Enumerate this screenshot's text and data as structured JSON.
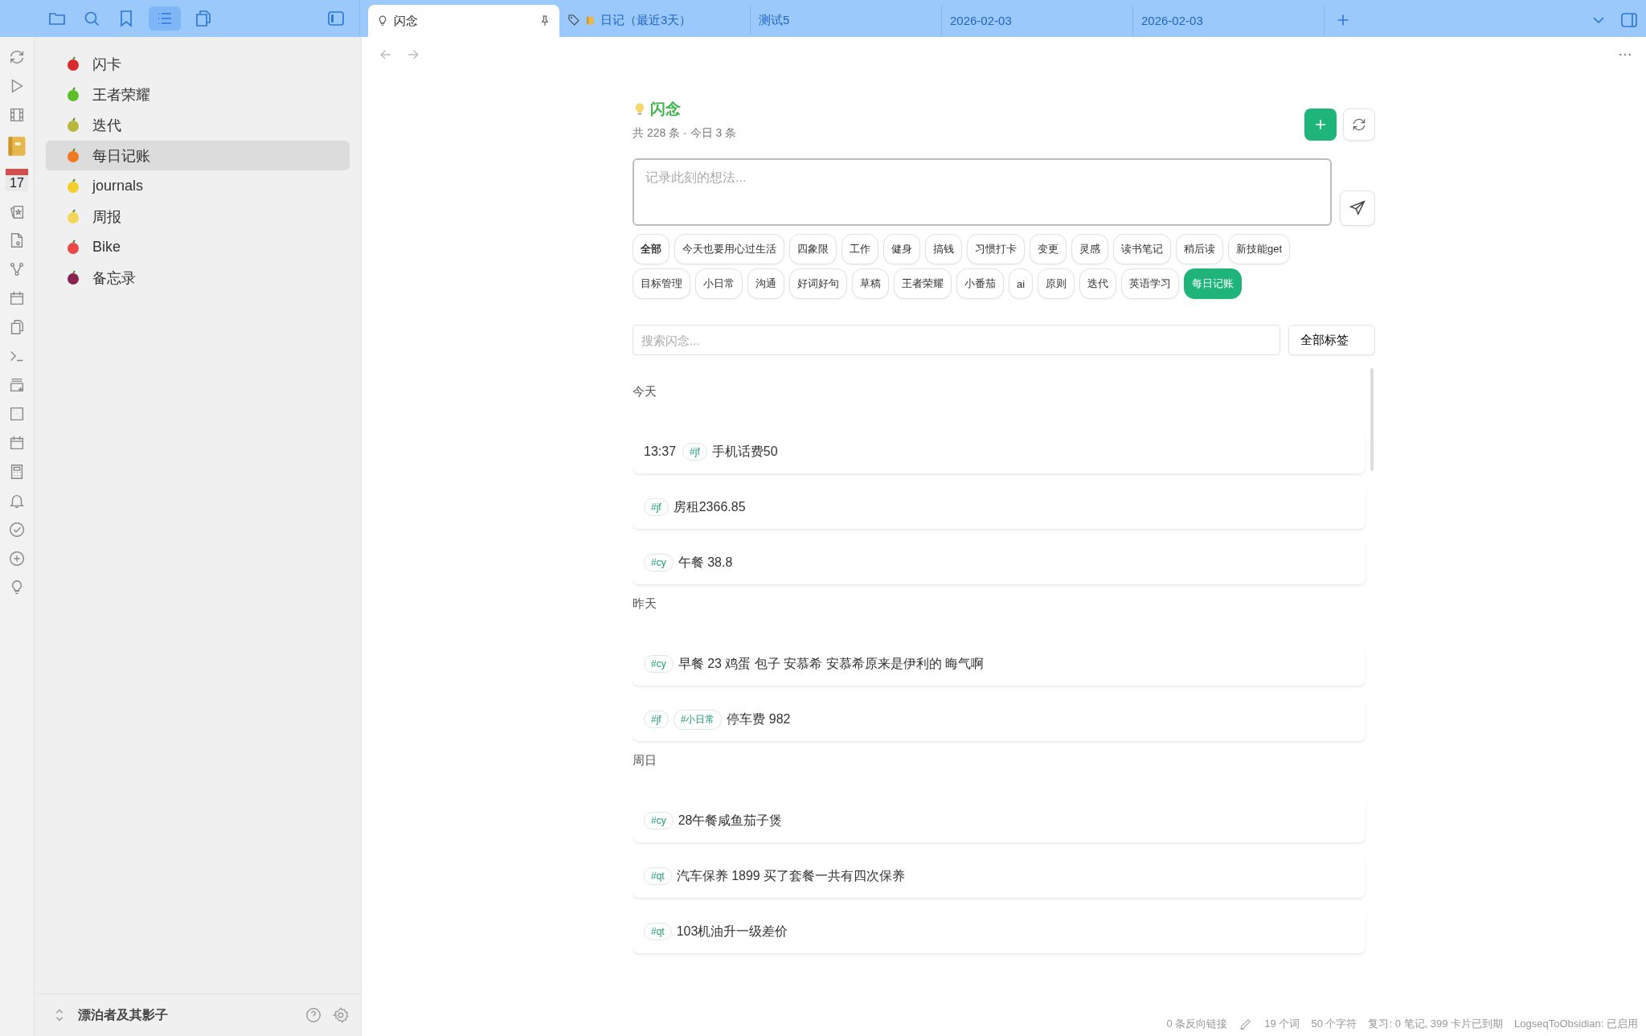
{
  "ribbon": {
    "calendar_day": "17"
  },
  "sidebar": {
    "items": [
      {
        "label": "闪卡",
        "selected": false
      },
      {
        "label": "王者荣耀",
        "selected": false
      },
      {
        "label": "迭代",
        "selected": false
      },
      {
        "label": "每日记账",
        "selected": true
      },
      {
        "label": "journals",
        "selected": false
      },
      {
        "label": "周报",
        "selected": false
      },
      {
        "label": "Bike",
        "selected": false
      },
      {
        "label": "备忘录",
        "selected": false
      }
    ],
    "vault": "漂泊者及其影子"
  },
  "tabs": [
    {
      "label": "闪念",
      "selected": true,
      "kind": "flash"
    },
    {
      "label": "日记（最近3天）",
      "selected": false,
      "kind": "tagged"
    },
    {
      "label": "测试5",
      "selected": false,
      "kind": "plain"
    },
    {
      "label": "2026-02-03",
      "selected": false,
      "kind": "plain"
    },
    {
      "label": "2026-02-03",
      "selected": false,
      "kind": "plain"
    }
  ],
  "page": {
    "title": "闪念",
    "subtitle": "共 228 条 · 今日 3 条",
    "input": {
      "placeholder": "记录此刻的想法..."
    },
    "tags": [
      {
        "label": "全部",
        "selected": false
      },
      {
        "label": "今天也要用心过生活",
        "selected": false
      },
      {
        "label": "四象限",
        "selected": false
      },
      {
        "label": "工作",
        "selected": false
      },
      {
        "label": "健身",
        "selected": false
      },
      {
        "label": "搞钱",
        "selected": false
      },
      {
        "label": "习惯打卡",
        "selected": false
      },
      {
        "label": "变更",
        "selected": false
      },
      {
        "label": "灵感",
        "selected": false
      },
      {
        "label": "读书笔记",
        "selected": false
      },
      {
        "label": "稍后读",
        "selected": false
      },
      {
        "label": "新技能get",
        "selected": false
      },
      {
        "label": "目标管理",
        "selected": false
      },
      {
        "label": "小日常",
        "selected": false
      },
      {
        "label": "沟通",
        "selected": false
      },
      {
        "label": "好词好句",
        "selected": false
      },
      {
        "label": "草稿",
        "selected": false
      },
      {
        "label": "王者荣耀",
        "selected": false
      },
      {
        "label": "小番茄",
        "selected": false
      },
      {
        "label": "ai",
        "selected": false
      },
      {
        "label": "原则",
        "selected": false
      },
      {
        "label": "迭代",
        "selected": false
      },
      {
        "label": "英语学习",
        "selected": false
      },
      {
        "label": "每日记账",
        "selected": true
      }
    ],
    "search": {
      "placeholder": "搜索闪念..."
    },
    "all_tags_button": "全部标签",
    "groups": [
      {
        "label": "今天",
        "entries": [
          {
            "time": "13:37",
            "tags": [
              "#jf"
            ],
            "text": "手机话费50"
          },
          {
            "tags": [
              "#jf"
            ],
            "text": "房租2366.85"
          },
          {
            "tags": [
              "#cy"
            ],
            "text": "午餐 38.8"
          }
        ]
      },
      {
        "label": "昨天",
        "entries": [
          {
            "tags": [
              "#cy"
            ],
            "text": "早餐 23 鸡蛋 包子 安慕希 安慕希原来是伊利的 晦气啊"
          },
          {
            "tags": [
              "#jf",
              "#小日常"
            ],
            "text": "停车费 982"
          }
        ]
      },
      {
        "label": "周日",
        "entries": [
          {
            "tags": [
              "#cy"
            ],
            "text": "28午餐咸鱼茄子煲"
          },
          {
            "tags": [
              "#qt"
            ],
            "text": "汽车保养 1899 买了套餐一共有四次保养"
          },
          {
            "tags": [
              "#qt"
            ],
            "text": "103机油升一级差价"
          }
        ]
      }
    ]
  },
  "status_bar": {
    "backlinks": "0 条反向链接",
    "words": "19 个词",
    "chars": "50 个字符",
    "review": "复习: 0 笔记, 399 卡片已到期",
    "plugin": "LogseqToObsidian: 已启用"
  }
}
